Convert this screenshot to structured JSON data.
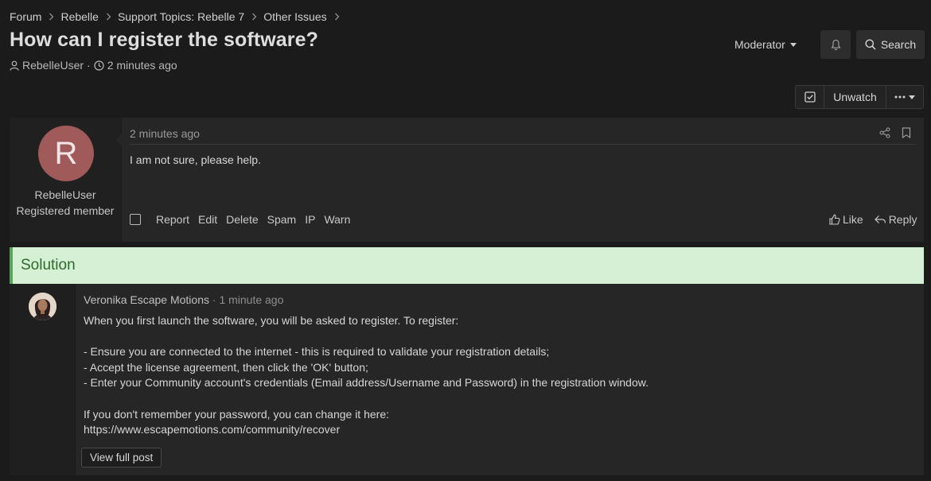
{
  "breadcrumb": [
    "Forum",
    "Rebelle",
    "Support Topics: Rebelle 7",
    "Other Issues"
  ],
  "thread": {
    "title": "How can I register the software?",
    "author": "RebelleUser",
    "time": "2 minutes ago"
  },
  "header": {
    "moderator_label": "Moderator",
    "search_label": "Search"
  },
  "watch": {
    "unwatch_label": "Unwatch"
  },
  "post": {
    "avatar_letter": "R",
    "avatar_color": "#a05a5a",
    "username": "RebelleUser",
    "user_title": "Registered member",
    "time": "2 minutes ago",
    "body": "I am not sure, please help.",
    "actions": [
      "Report",
      "Edit",
      "Delete",
      "Spam",
      "IP",
      "Warn"
    ],
    "like_label": "Like",
    "reply_label": "Reply"
  },
  "solution": {
    "heading": "Solution",
    "author": "Veronika Escape Motions",
    "separator": " · ",
    "time": "1 minute ago",
    "body": "When you first launch the software, you will be asked to register. To register:\n\n- Ensure you are connected to the internet - this is required to validate your registration details;\n- Accept the license agreement, then click the 'OK' button;\n- Enter your Community account's credentials (Email address/Username and Password) in the registration window.\n\nIf you don't remember your password, you can change it here:\nhttps://www.escapemotions.com/community/recover",
    "view_full_label": "View full post"
  },
  "colors": {
    "solution_bg": "#d5f0d5",
    "solution_accent": "#5aa65a",
    "solution_text": "#2e6a2e"
  }
}
